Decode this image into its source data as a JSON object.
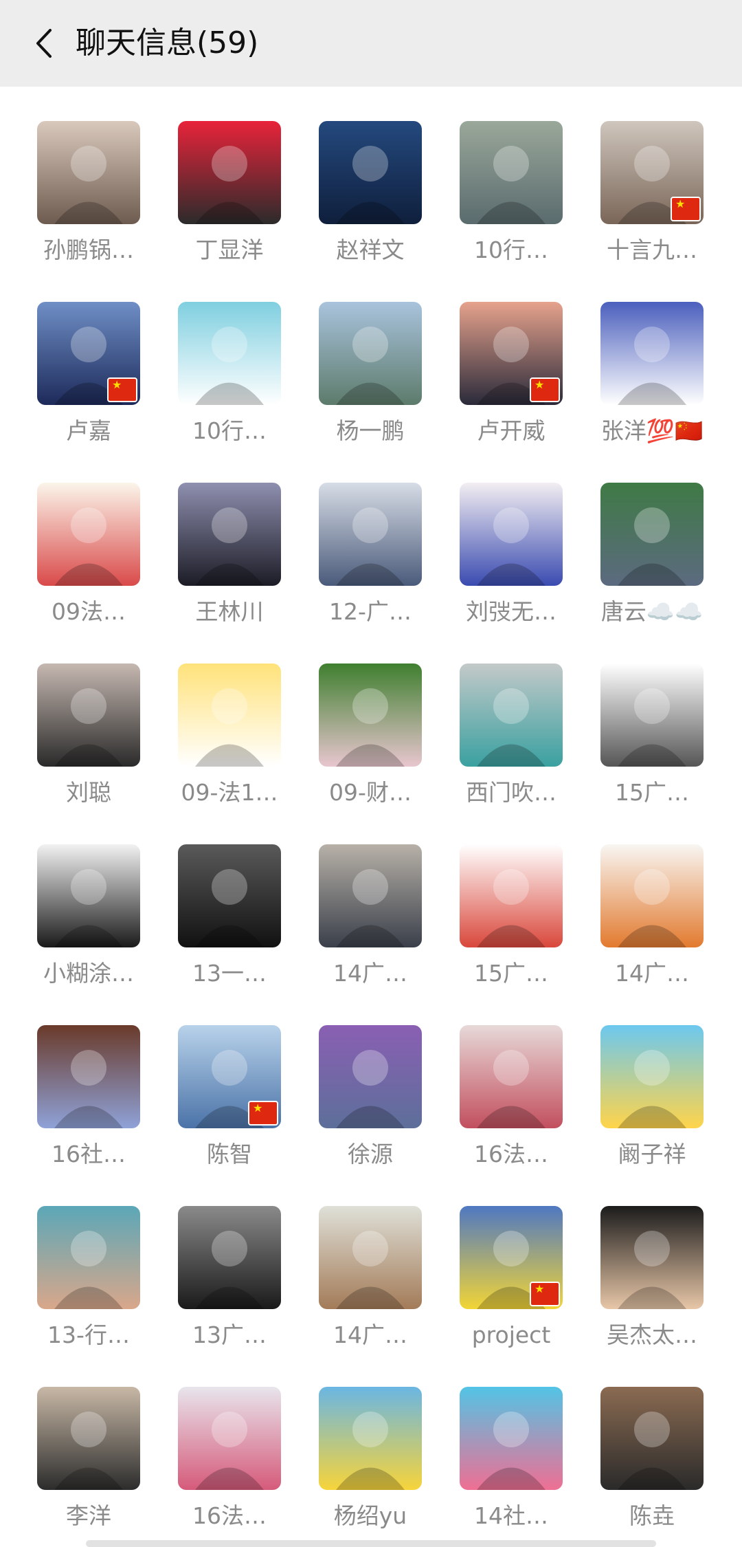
{
  "header": {
    "title": "聊天信息(59)"
  },
  "colors": {
    "header_bg": "#ededed",
    "name_text": "#8a8a8a",
    "title_text": "#111111"
  },
  "members": [
    {
      "name": "孙鹏锅…",
      "icon": "avatar-woman-with-baby",
      "flag": false,
      "c1": "#d9c9bc",
      "c2": "#6e5b4f"
    },
    {
      "name": "丁显洋",
      "icon": "avatar-cartoon-face-red",
      "flag": false,
      "c1": "#e8233a",
      "c2": "#2b2b2b"
    },
    {
      "name": "赵祥文",
      "icon": "avatar-man-in-suit",
      "flag": false,
      "c1": "#24497e",
      "c2": "#0f1f3c"
    },
    {
      "name": "10行…",
      "icon": "avatar-child-outdoors",
      "flag": false,
      "c1": "#9aa89a",
      "c2": "#5a6b6e"
    },
    {
      "name": "十言九…",
      "icon": "avatar-torso",
      "flag": true,
      "c1": "#cfc6bd",
      "c2": "#7a6658"
    },
    {
      "name": "卢嘉",
      "icon": "avatar-lake-landscape",
      "flag": true,
      "c1": "#6f8fc6",
      "c2": "#1d2a5a"
    },
    {
      "name": "10行…",
      "icon": "avatar-cartoon-dog",
      "flag": false,
      "c1": "#7fcfe0",
      "c2": "#ffffff"
    },
    {
      "name": "杨一鹏",
      "icon": "avatar-scenic-sky",
      "flag": false,
      "c1": "#a9c3dd",
      "c2": "#5d7b6b"
    },
    {
      "name": "卢开威",
      "icon": "avatar-silhouette-sunset",
      "flag": true,
      "c1": "#e6a28c",
      "c2": "#2a2a3a"
    },
    {
      "name": "张洋💯🇨🇳",
      "icon": "avatar-cartoon-cat-boy",
      "flag": false,
      "c1": "#4b5fbd",
      "c2": "#ffffff"
    },
    {
      "name": "09法…",
      "icon": "avatar-cartoon-fish",
      "flag": false,
      "c1": "#fbf5ea",
      "c2": "#d94a4a"
    },
    {
      "name": "王林川",
      "icon": "avatar-man-in-suit",
      "flag": false,
      "c1": "#8f8fb0",
      "c2": "#1c1c26"
    },
    {
      "name": "12-广…",
      "icon": "avatar-young-boy",
      "flag": false,
      "c1": "#d7dde6",
      "c2": "#4a5a7a"
    },
    {
      "name": "刘弢无…",
      "icon": "avatar-stitch-art",
      "flag": false,
      "c1": "#f3eef2",
      "c2": "#3a4bb0"
    },
    {
      "name": "唐云☁️☁️",
      "icon": "avatar-muscular-man",
      "flag": false,
      "c1": "#3f7a45",
      "c2": "#5c6a80"
    },
    {
      "name": "刘聪",
      "icon": "avatar-couple-selfie",
      "flag": false,
      "c1": "#c6b8b1",
      "c2": "#2a2a2a"
    },
    {
      "name": "09-法1…",
      "icon": "avatar-cartoon-piglets",
      "flag": false,
      "c1": "#ffe27a",
      "c2": "#ffffff"
    },
    {
      "name": "09-财…",
      "icon": "avatar-child-garden",
      "flag": false,
      "c1": "#3f7f2f",
      "c2": "#e8c6cf"
    },
    {
      "name": "西门吹…",
      "icon": "avatar-man-sitting",
      "flag": false,
      "c1": "#c4c9c9",
      "c2": "#3aa0a0"
    },
    {
      "name": "15广…",
      "icon": "avatar-sketch-face",
      "flag": false,
      "c1": "#ffffff",
      "c2": "#555555"
    },
    {
      "name": "小糊涂…",
      "icon": "avatar-sketch-boy-hat",
      "flag": false,
      "c1": "#f2f2f2",
      "c2": "#1a1a1a"
    },
    {
      "name": "13一…",
      "icon": "avatar-man-in-suit",
      "flag": false,
      "c1": "#5a5a5a",
      "c2": "#111111"
    },
    {
      "name": "14广…",
      "icon": "avatar-man-at-board",
      "flag": false,
      "c1": "#b7b1a8",
      "c2": "#3a3f4a"
    },
    {
      "name": "15广…",
      "icon": "avatar-bearded-art",
      "flag": false,
      "c1": "#ffffff",
      "c2": "#d9473b"
    },
    {
      "name": "14广…",
      "icon": "avatar-bunny-carrot",
      "flag": false,
      "c1": "#f8f6f3",
      "c2": "#e27a2f"
    },
    {
      "name": "16社…",
      "icon": "avatar-hooded-man",
      "flag": false,
      "c1": "#6a3a2a",
      "c2": "#8fa2d8"
    },
    {
      "name": "陈智",
      "icon": "avatar-sky-jumper",
      "flag": true,
      "c1": "#b8d2ea",
      "c2": "#4b73a8"
    },
    {
      "name": "徐源",
      "icon": "avatar-cartoon-tom-cat",
      "flag": false,
      "c1": "#8a5fb3",
      "c2": "#5d6f9a"
    },
    {
      "name": "16法…",
      "icon": "avatar-child-airplane",
      "flag": false,
      "c1": "#e7d9d8",
      "c2": "#c24f5e"
    },
    {
      "name": "阚子祥",
      "icon": "avatar-cartoon-pig-split",
      "flag": false,
      "c1": "#6cc8ef",
      "c2": "#ffd44a"
    },
    {
      "name": "13-行…",
      "icon": "avatar-man-thinking",
      "flag": false,
      "c1": "#5ba7b8",
      "c2": "#d9a78a"
    },
    {
      "name": "13广…",
      "icon": "avatar-dark-warrior",
      "flag": false,
      "c1": "#8a8a8a",
      "c2": "#1a1a1a"
    },
    {
      "name": "14广…",
      "icon": "avatar-teddy-bear",
      "flag": false,
      "c1": "#dfe0d8",
      "c2": "#a37b58"
    },
    {
      "name": "project",
      "icon": "avatar-spongebob",
      "flag": true,
      "c1": "#4f78c2",
      "c2": "#f2d536"
    },
    {
      "name": "吴杰太…",
      "icon": "avatar-two-photos",
      "flag": false,
      "c1": "#1b1b1b",
      "c2": "#e8c7a8"
    },
    {
      "name": "李洋",
      "icon": "avatar-man-gaming",
      "flag": false,
      "c1": "#c8b8a6",
      "c2": "#2c2c2c"
    },
    {
      "name": "16法…",
      "icon": "avatar-anime-pink-hair",
      "flag": false,
      "c1": "#e8e5ec",
      "c2": "#d55a7a"
    },
    {
      "name": "杨绍yu",
      "icon": "avatar-pikachu",
      "flag": false,
      "c1": "#6ab6e3",
      "c2": "#f7d43a"
    },
    {
      "name": "14社…",
      "icon": "avatar-pink-bear",
      "flag": false,
      "c1": "#52c4e6",
      "c2": "#ef6f93"
    },
    {
      "name": "陈垚",
      "icon": "avatar-man-glasses",
      "flag": false,
      "c1": "#8b6b52",
      "c2": "#2a2a2a"
    }
  ]
}
